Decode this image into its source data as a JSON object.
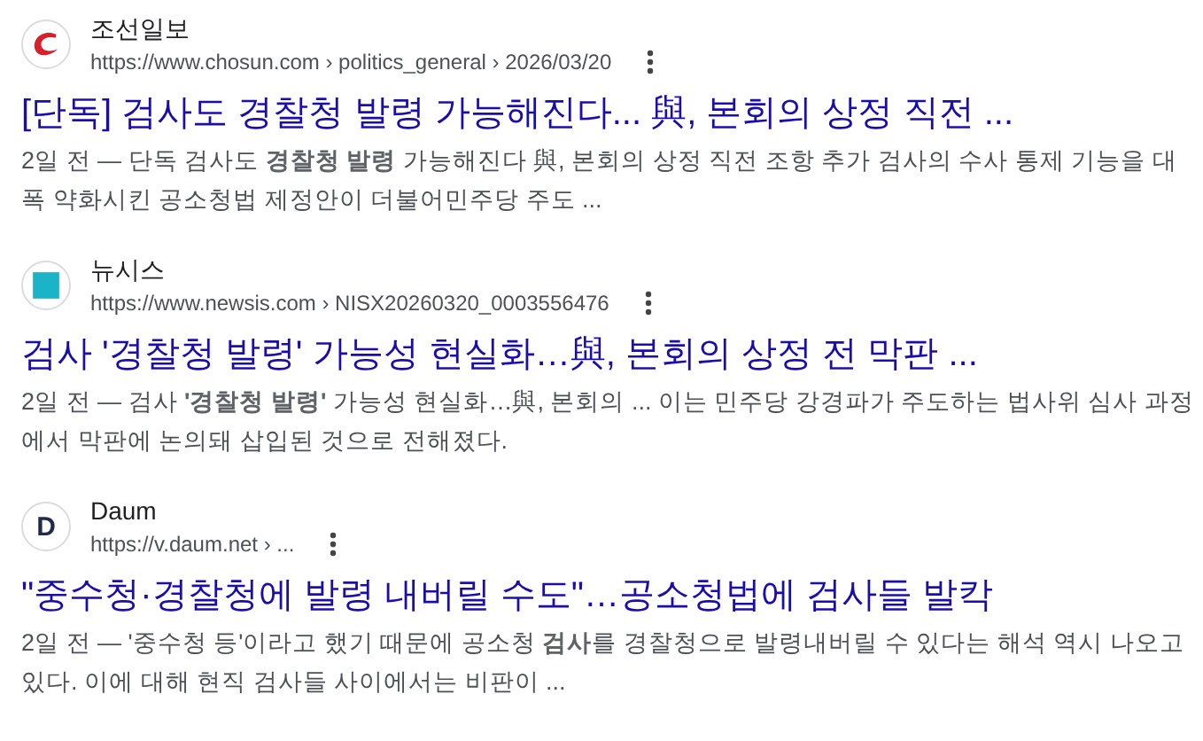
{
  "results": [
    {
      "favicon": {
        "kind": "chosun"
      },
      "site": "조선일보",
      "url": "https://www.chosun.com › politics_general › 2026/03/20",
      "title": "[단독] 검사도 경찰청 발령 가능해진다... 與, 본회의 상정 직전 ...",
      "snippet": "2일 전 — 단독 검사도 **경찰청 발령** 가능해진다 與, 본회의 상정 직전 조항 추가 검사의 수사 통제 기능을 대폭 약화시킨 공소청법 제정안이 더불어민주당 주도 ..."
    },
    {
      "favicon": {
        "kind": "newsis"
      },
      "site": "뉴시스",
      "url": "https://www.newsis.com › NISX20260320_0003556476",
      "title": "검사 '경찰청 발령' 가능성 현실화…與, 본회의 상정 전 막판 ...",
      "snippet": "2일 전 — 검사 **'경찰청 발령'** 가능성 현실화…與, 본회의 ... 이는 민주당 강경파가 주도하는 법사위 심사 과정에서 막판에 논의돼 삽입된 것으로 전해졌다."
    },
    {
      "favicon": {
        "kind": "daum",
        "letter": "D"
      },
      "site": "Daum",
      "url": "https://v.daum.net › ...",
      "title": "\"중수청·경찰청에 발령 내버릴 수도\"…공소청법에 검사들 발칵",
      "snippet": "2일 전 — '중수청 등'이라고 했기 때문에 공소청 **검사**를 경찰청으로 발령내버릴 수 있다는 해석 역시 나오고 있다. 이에 대해 현직 검사들 사이에서는 비판이 ..."
    }
  ]
}
